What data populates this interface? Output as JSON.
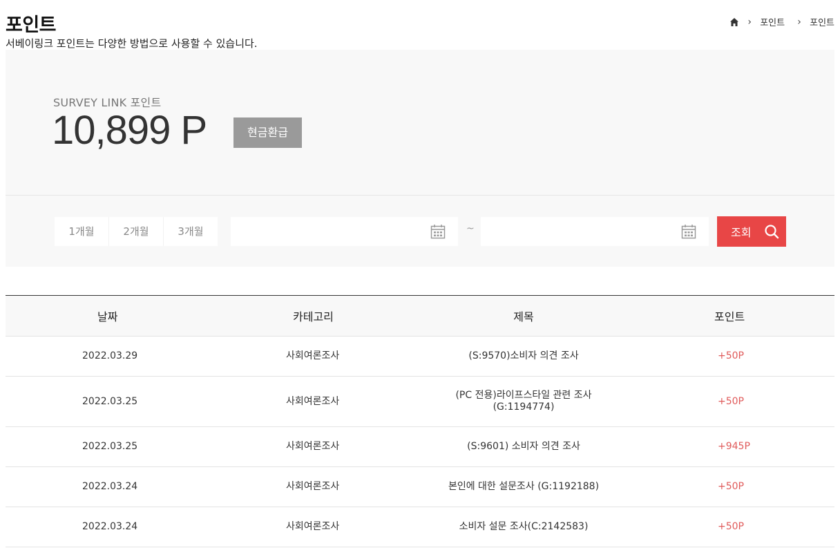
{
  "header": {
    "title": "포인트",
    "description": "서베이링크 포인트는 다양한 방법으로 사용할 수 있습니다.",
    "breadcrumb": [
      "포인트",
      "포인트"
    ]
  },
  "summary": {
    "label": "SURVEY LINK 포인트",
    "value": "10,899 P",
    "refund_label": "현금환급"
  },
  "filter": {
    "periods": [
      "1개월",
      "2개월",
      "3개월"
    ],
    "start_date": "",
    "end_date": "",
    "separator": "~",
    "search_label": "조회"
  },
  "colors": {
    "accent": "#e84646",
    "point_text": "#e05a5a",
    "panel_bg": "#f8f8f8",
    "refund_bg": "#9a9a9a"
  },
  "table": {
    "headers": [
      "날짜",
      "카테고리",
      "제목",
      "포인트"
    ],
    "rows": [
      {
        "date": "2022.03.29",
        "category": "사회여론조사",
        "title": "(S:9570)소비자 의견 조사",
        "point": "+50P"
      },
      {
        "date": "2022.03.25",
        "category": "사회여론조사",
        "title": "(PC 전용)라이프스타일 관련 조사\n(G:1194774)",
        "point": "+50P"
      },
      {
        "date": "2022.03.25",
        "category": "사회여론조사",
        "title": "(S:9601) 소비자 의견 조사",
        "point": "+945P"
      },
      {
        "date": "2022.03.24",
        "category": "사회여론조사",
        "title": "본인에 대한 설문조사 (G:1192188)",
        "point": "+50P"
      },
      {
        "date": "2022.03.24",
        "category": "사회여론조사",
        "title": "소비자 설문 조사(C:2142583)",
        "point": "+50P"
      }
    ]
  }
}
